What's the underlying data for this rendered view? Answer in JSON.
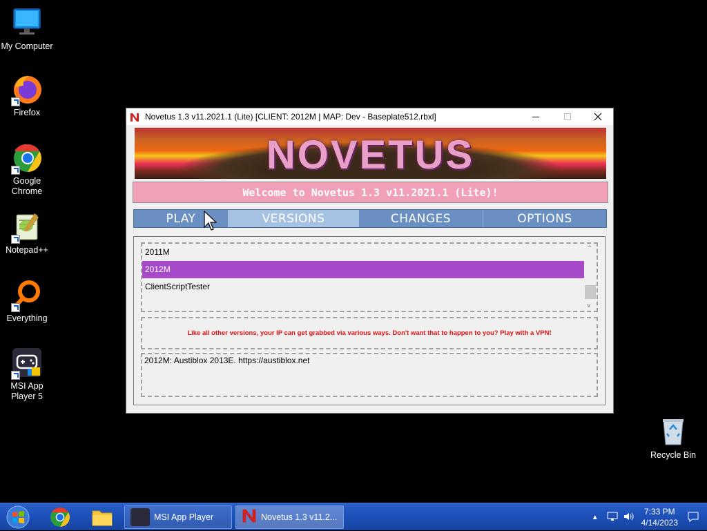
{
  "desktop": {
    "icons": [
      {
        "label": "My Computer"
      },
      {
        "label": "Firefox"
      },
      {
        "label": "Google Chrome"
      },
      {
        "label": "Notepad++"
      },
      {
        "label": "Everything"
      },
      {
        "label": "MSI App Player 5"
      },
      {
        "label": "Recycle Bin"
      }
    ]
  },
  "window": {
    "title": "Novetus 1.3 v11.2021.1 (Lite) [CLIENT: 2012M | MAP: Dev - Baseplate512.rbxl]",
    "banner_text": "NOVETUS",
    "welcome": "Welcome to Novetus 1.3 v11.2021.1 (Lite)!",
    "tabs": [
      "PLAY",
      "VERSIONS",
      "CHANGES",
      "OPTIONS"
    ],
    "active_tab": "VERSIONS",
    "versions": [
      "2011M",
      "2012M",
      "ClientScriptTester"
    ],
    "selected_version": "2012M",
    "warning": "Like all other versions, your IP can get grabbed via various ways. Don't want that to happen to you? Play with a VPN!",
    "description": "2012M: Austiblox 2013E. https://austiblox.net"
  },
  "taskbar": {
    "tasks": [
      {
        "label": "MSI App Player"
      },
      {
        "label": "Novetus 1.3 v11.2..."
      }
    ],
    "time": "7:33 PM",
    "date": "4/14/2023"
  },
  "colors": {
    "selection": "#a64ac9",
    "tab_blue": "#6a8fc2",
    "tab_active": "#a5c2e2",
    "welcome_bg": "#f1a0b8",
    "warning_text": "#e01010"
  }
}
